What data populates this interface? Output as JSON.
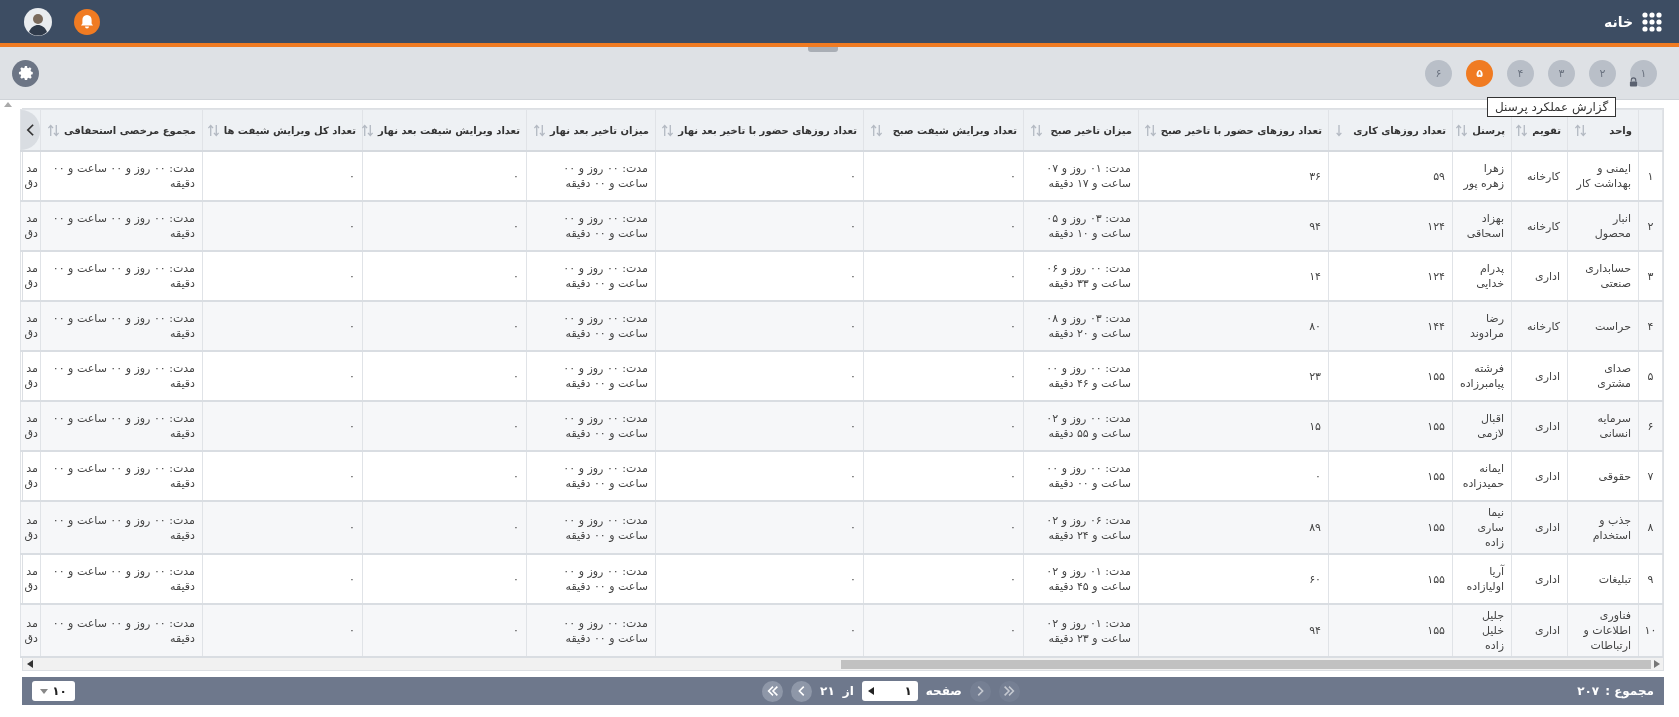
{
  "header": {
    "title": "خانه",
    "notifications": true
  },
  "steps": [
    {
      "label": "۱",
      "selected": false,
      "locked": true
    },
    {
      "label": "۲",
      "selected": false,
      "locked": false
    },
    {
      "label": "۳",
      "selected": false,
      "locked": false
    },
    {
      "label": "۴",
      "selected": false,
      "locked": false
    },
    {
      "label": "۵",
      "selected": true,
      "locked": false
    },
    {
      "label": "۶",
      "selected": false,
      "locked": false
    }
  ],
  "tooltip": "گزارش عملکرد پرسنل",
  "table": {
    "columns": [
      {
        "label": "واحد",
        "sorted": false
      },
      {
        "label": "تقویم",
        "sorted": false
      },
      {
        "label": "پرسنل",
        "sorted": false
      },
      {
        "label": "تعداد روزهای کاری",
        "sorted": true
      },
      {
        "label": "تعداد روزهای حضور با تاخیر صبح",
        "sorted": false
      },
      {
        "label": "میزان تاخیر صبح",
        "sorted": false
      },
      {
        "label": "تعداد ویرایش شیفت صبح",
        "sorted": false
      },
      {
        "label": "تعداد روزهای حضور با تاخیر بعد نهار",
        "sorted": false
      },
      {
        "label": "میزان تاخیر بعد نهار",
        "sorted": false
      },
      {
        "label": "تعداد ویرایش شیفت بعد نهار",
        "sorted": false
      },
      {
        "label": "تعداد کل ویرایش شیفت ها",
        "sorted": false
      },
      {
        "label": "مجموع مرخصی استحقاقی",
        "sorted": false
      }
    ],
    "rows": [
      {
        "number": "۱",
        "cells": [
          "ایمنی و بهداشت کار",
          "کارخانه",
          "زهرا زهره پور",
          "۵۹",
          "۳۶",
          "مدت: ۰۱ روز و ۰۷ ساعت و ۱۷ دقیقه",
          "۰",
          "۰",
          "مدت: ۰۰ روز و ۰۰ ساعت و ۰۰ دقیقه",
          "۰",
          "۰",
          "مدت: ۰۰ روز و ۰۰ ساعت و ۰۰ دقیقه"
        ],
        "column_14": [
          "مد",
          "دق"
        ]
      },
      {
        "number": "۲",
        "cells": [
          "انبار محصول",
          "کارخانه",
          "بهزاد اسحاقی",
          "۱۲۴",
          "۹۴",
          "مدت: ۰۳ روز و ۰۵ ساعت و ۱۰ دقیقه",
          "۰",
          "۰",
          "مدت: ۰۰ روز و ۰۰ ساعت و ۰۰ دقیقه",
          "۰",
          "۰",
          "مدت: ۰۰ روز و ۰۰ ساعت و ۰۰ دقیقه"
        ],
        "column_14": [
          "مد",
          "دق"
        ]
      },
      {
        "number": "۳",
        "cells": [
          "حسابداری صنعتی",
          "اداری",
          "پدرام خدایی",
          "۱۲۴",
          "۱۴",
          "مدت: ۰۰ روز و ۰۶ ساعت و ۳۳ دقیقه",
          "۰",
          "۰",
          "مدت: ۰۰ روز و ۰۰ ساعت و ۰۰ دقیقه",
          "۰",
          "۰",
          "مدت: ۰۰ روز و ۰۰ ساعت و ۰۰ دقیقه"
        ],
        "column_14": [
          "مد",
          "دق"
        ]
      },
      {
        "number": "۴",
        "cells": [
          "حراست",
          "کارخانه",
          "رضا مرادوند",
          "۱۴۴",
          "۸۰",
          "مدت: ۰۳ روز و ۰۸ ساعت و ۲۰ دقیقه",
          "۰",
          "۰",
          "مدت: ۰۰ روز و ۰۰ ساعت و ۰۰ دقیقه",
          "۰",
          "۰",
          "مدت: ۰۰ روز و ۰۰ ساعت و ۰۰ دقیقه"
        ],
        "column_14": [
          "مد",
          "دق"
        ]
      },
      {
        "number": "۵",
        "cells": [
          "صدای مشتری",
          "اداری",
          "فرشته پیامبرزاده",
          "۱۵۵",
          "۲۳",
          "مدت: ۰۰ روز و ۰۰ ساعت و ۴۶ دقیقه",
          "۰",
          "۰",
          "مدت: ۰۰ روز و ۰۰ ساعت و ۰۰ دقیقه",
          "۰",
          "۰",
          "مدت: ۰۰ روز و ۰۰ ساعت و ۰۰ دقیقه"
        ],
        "column_14": [
          "مد",
          "دق"
        ]
      },
      {
        "number": "۶",
        "cells": [
          "سرمایه انسانی",
          "اداری",
          "اقبال لازمی",
          "۱۵۵",
          "۱۵",
          "مدت: ۰۰ روز و ۰۲ ساعت و ۵۵ دقیقه",
          "۰",
          "۰",
          "مدت: ۰۰ روز و ۰۰ ساعت و ۰۰ دقیقه",
          "۰",
          "۰",
          "مدت: ۰۰ روز و ۰۰ ساعت و ۰۰ دقیقه"
        ],
        "column_14": [
          "مد",
          "دق"
        ]
      },
      {
        "number": "۷",
        "cells": [
          "حقوقی",
          "اداری",
          "ایمانه حمیدزاده",
          "۱۵۵",
          "۰",
          "مدت: ۰۰ روز و ۰۰ ساعت و ۰۰ دقیقه",
          "۰",
          "۰",
          "مدت: ۰۰ روز و ۰۰ ساعت و ۰۰ دقیقه",
          "۰",
          "۰",
          "مدت: ۰۰ روز و ۰۰ ساعت و ۰۰ دقیقه"
        ],
        "column_14": [
          "مد",
          "دق"
        ]
      },
      {
        "number": "۸",
        "cells": [
          "جذب و استخدام",
          "اداری",
          "نیما ساری زاده",
          "۱۵۵",
          "۸۹",
          "مدت: ۰۶ روز و ۰۲ ساعت و ۲۴ دقیقه",
          "۰",
          "۰",
          "مدت: ۰۰ روز و ۰۰ ساعت و ۰۰ دقیقه",
          "۰",
          "۰",
          "مدت: ۰۰ روز و ۰۰ ساعت و ۰۰ دقیقه"
        ],
        "column_14": [
          "مد",
          "دق"
        ]
      },
      {
        "number": "۹",
        "cells": [
          "تبلیغات",
          "اداری",
          "آریا اولیازاده",
          "۱۵۵",
          "۶۰",
          "مدت: ۰۱ روز و ۰۲ ساعت و ۴۵ دقیقه",
          "۰",
          "۰",
          "مدت: ۰۰ روز و ۰۰ ساعت و ۰۰ دقیقه",
          "۰",
          "۰",
          "مدت: ۰۰ روز و ۰۰ ساعت و ۰۰ دقیقه"
        ],
        "column_14": [
          "مد",
          "دق"
        ]
      },
      {
        "number": "۱۰",
        "cells": [
          "فناوری اطلاعات و ارتباطات",
          "اداری",
          "جلیل خلیل زاده",
          "۱۵۵",
          "۹۴",
          "مدت: ۰۱ روز و ۰۲ ساعت و ۲۳ دقیقه",
          "۰",
          "۰",
          "مدت: ۰۰ روز و ۰۰ ساعت و ۰۰ دقیقه",
          "۰",
          "۰",
          "مدت: ۰۰ روز و ۰۰ ساعت و ۰۰ دقیقه"
        ],
        "column_14": [
          "مد",
          "دق"
        ]
      }
    ]
  },
  "footer": {
    "total_label": "مجموع :",
    "total": "۲۰۷",
    "page_label": "صفحه",
    "page": "۱",
    "of_label": "از",
    "page_count": "۲۱",
    "page_size": "۱۰",
    "nav": [
      {
        "kind": "first",
        "disabled": true
      },
      {
        "kind": "prev",
        "disabled": true
      },
      {
        "kind": "next",
        "disabled": false
      },
      {
        "kind": "last",
        "disabled": false
      }
    ]
  }
}
